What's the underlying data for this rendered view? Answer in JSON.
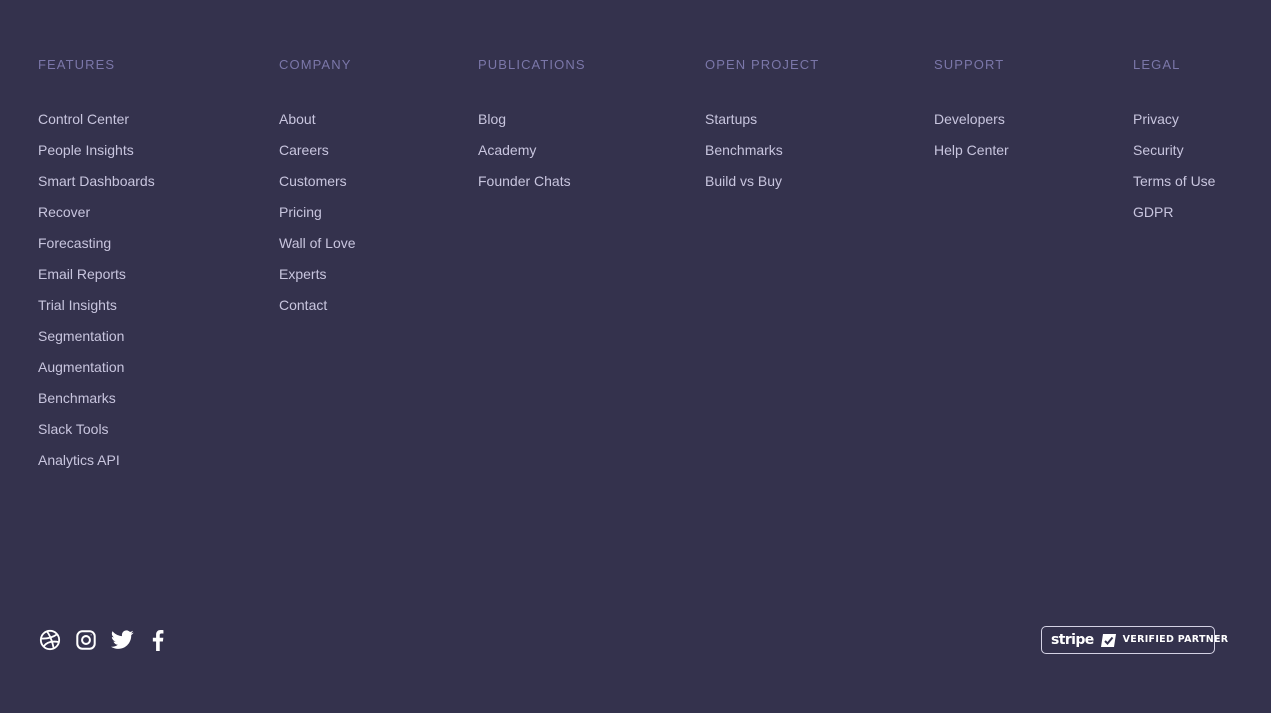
{
  "columns": {
    "features": {
      "heading": "FEATURES",
      "links": [
        "Control Center",
        "People Insights",
        "Smart Dashboards",
        "Recover",
        "Forecasting",
        "Email Reports",
        "Trial Insights",
        "Segmentation",
        "Augmentation",
        "Benchmarks",
        "Slack Tools",
        "Analytics API"
      ]
    },
    "company": {
      "heading": "COMPANY",
      "links": [
        "About",
        "Careers",
        "Customers",
        "Pricing",
        "Wall of Love",
        "Experts",
        "Contact"
      ]
    },
    "publications": {
      "heading": "PUBLICATIONS",
      "links": [
        "Blog",
        "Academy",
        "Founder Chats"
      ]
    },
    "open_project": {
      "heading": "OPEN PROJECT",
      "links": [
        "Startups",
        "Benchmarks",
        "Build vs Buy"
      ]
    },
    "support": {
      "heading": "SUPPORT",
      "links": [
        "Developers",
        "Help Center"
      ]
    },
    "legal": {
      "heading": "LEGAL",
      "links": [
        "Privacy",
        "Security",
        "Terms of Use",
        "GDPR"
      ]
    }
  },
  "socials": [
    "dribbble-icon",
    "instagram-icon",
    "twitter-icon",
    "facebook-icon"
  ],
  "badge": {
    "brand": "stripe",
    "label": "VERIFIED PARTNER"
  },
  "colors": {
    "background": "#34324d",
    "heading": "#7b77a9",
    "link": "#c8c5de",
    "icon": "#ffffff"
  }
}
